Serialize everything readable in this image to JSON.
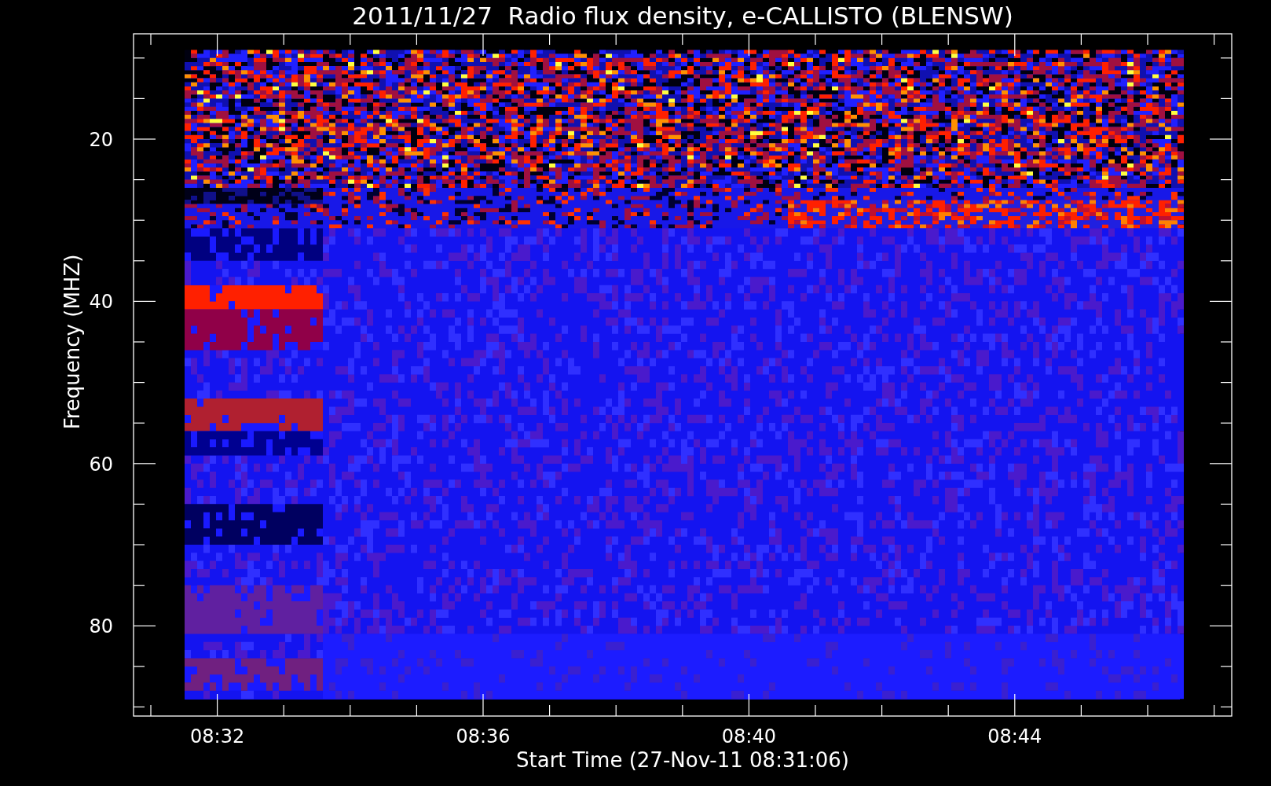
{
  "title": "2011/11/27  Radio flux density, e-CALLISTO (BLENSW)",
  "y_axis": {
    "label": "Frequency (MHZ)",
    "ticks": [
      "20",
      "40",
      "60",
      "80"
    ]
  },
  "x_axis": {
    "label": "Start Time (27-Nov-11 08:31:06)",
    "ticks": [
      "08:32",
      "08:36",
      "08:40",
      "08:44"
    ]
  }
}
